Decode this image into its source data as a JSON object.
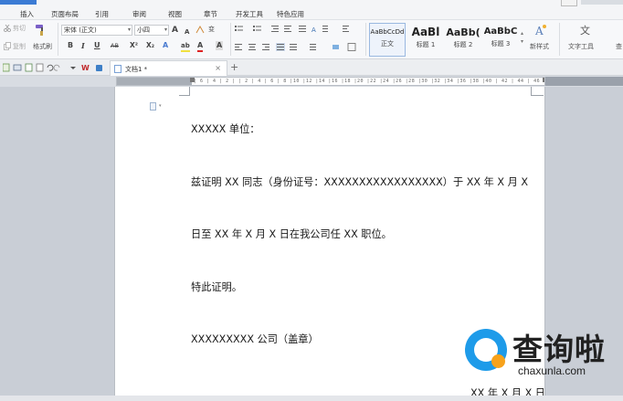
{
  "menu_tabs": [
    "插入",
    "页面布局",
    "引用",
    "审阅",
    "视图",
    "章节",
    "开发工具",
    "特色应用"
  ],
  "ribbon": {
    "cut": "剪切",
    "copy": "复制",
    "format_painter": "格式刷",
    "font_name": "宋体 (正文)",
    "font_size": "小四",
    "grow_font": "A",
    "shrink_font": "A",
    "phonetic": "变",
    "bold": "B",
    "italic": "I",
    "underline": "U",
    "strikethrough": "AB",
    "superscript": "X²",
    "subscript": "X₂",
    "text_effect": "A",
    "highlight": "ab",
    "font_color": "A",
    "char_border": "A",
    "styles": [
      {
        "sample": "AaBbCcDd",
        "name": "正文"
      },
      {
        "sample": "AaBl",
        "name": "标题 1"
      },
      {
        "sample": "AaBb(",
        "name": "标题 2"
      },
      {
        "sample": "AaBbC",
        "name": "标题 3"
      }
    ],
    "new_style": "新样式",
    "text_tools": "文字工具",
    "find_replace": "查"
  },
  "document_tab": {
    "name": "文档1 *",
    "close": "×",
    "add": "+"
  },
  "ruler_ticks": "| 6 | 4 | 2 |   | 2 | 4 | 6 | 8 |10 |12 |14 |16 |18 |20 |22 |24 |26 |28 |30 |32 |34 |36 |38 |40 | 42 | 44 | 46",
  "document": {
    "paragraphs": [
      "XXXXX 单位：",
      "兹证明 XX 同志（身份证号：XXXXXXXXXXXXXXXXX）于 XX 年 X 月 X",
      "日至 XX 年 X 月 X 日在我公司任 XX 职位。",
      "特此证明。",
      "XXXXXXXXX 公司（盖章）",
      "XX 年 X 月 X 日"
    ]
  },
  "watermark": {
    "brand_cn": "查询啦",
    "url": "chaxunla.com"
  },
  "colors": {
    "accent": "#3b7bd4",
    "watermark_blue": "#1e9be9",
    "watermark_orange": "#f7a21b"
  }
}
